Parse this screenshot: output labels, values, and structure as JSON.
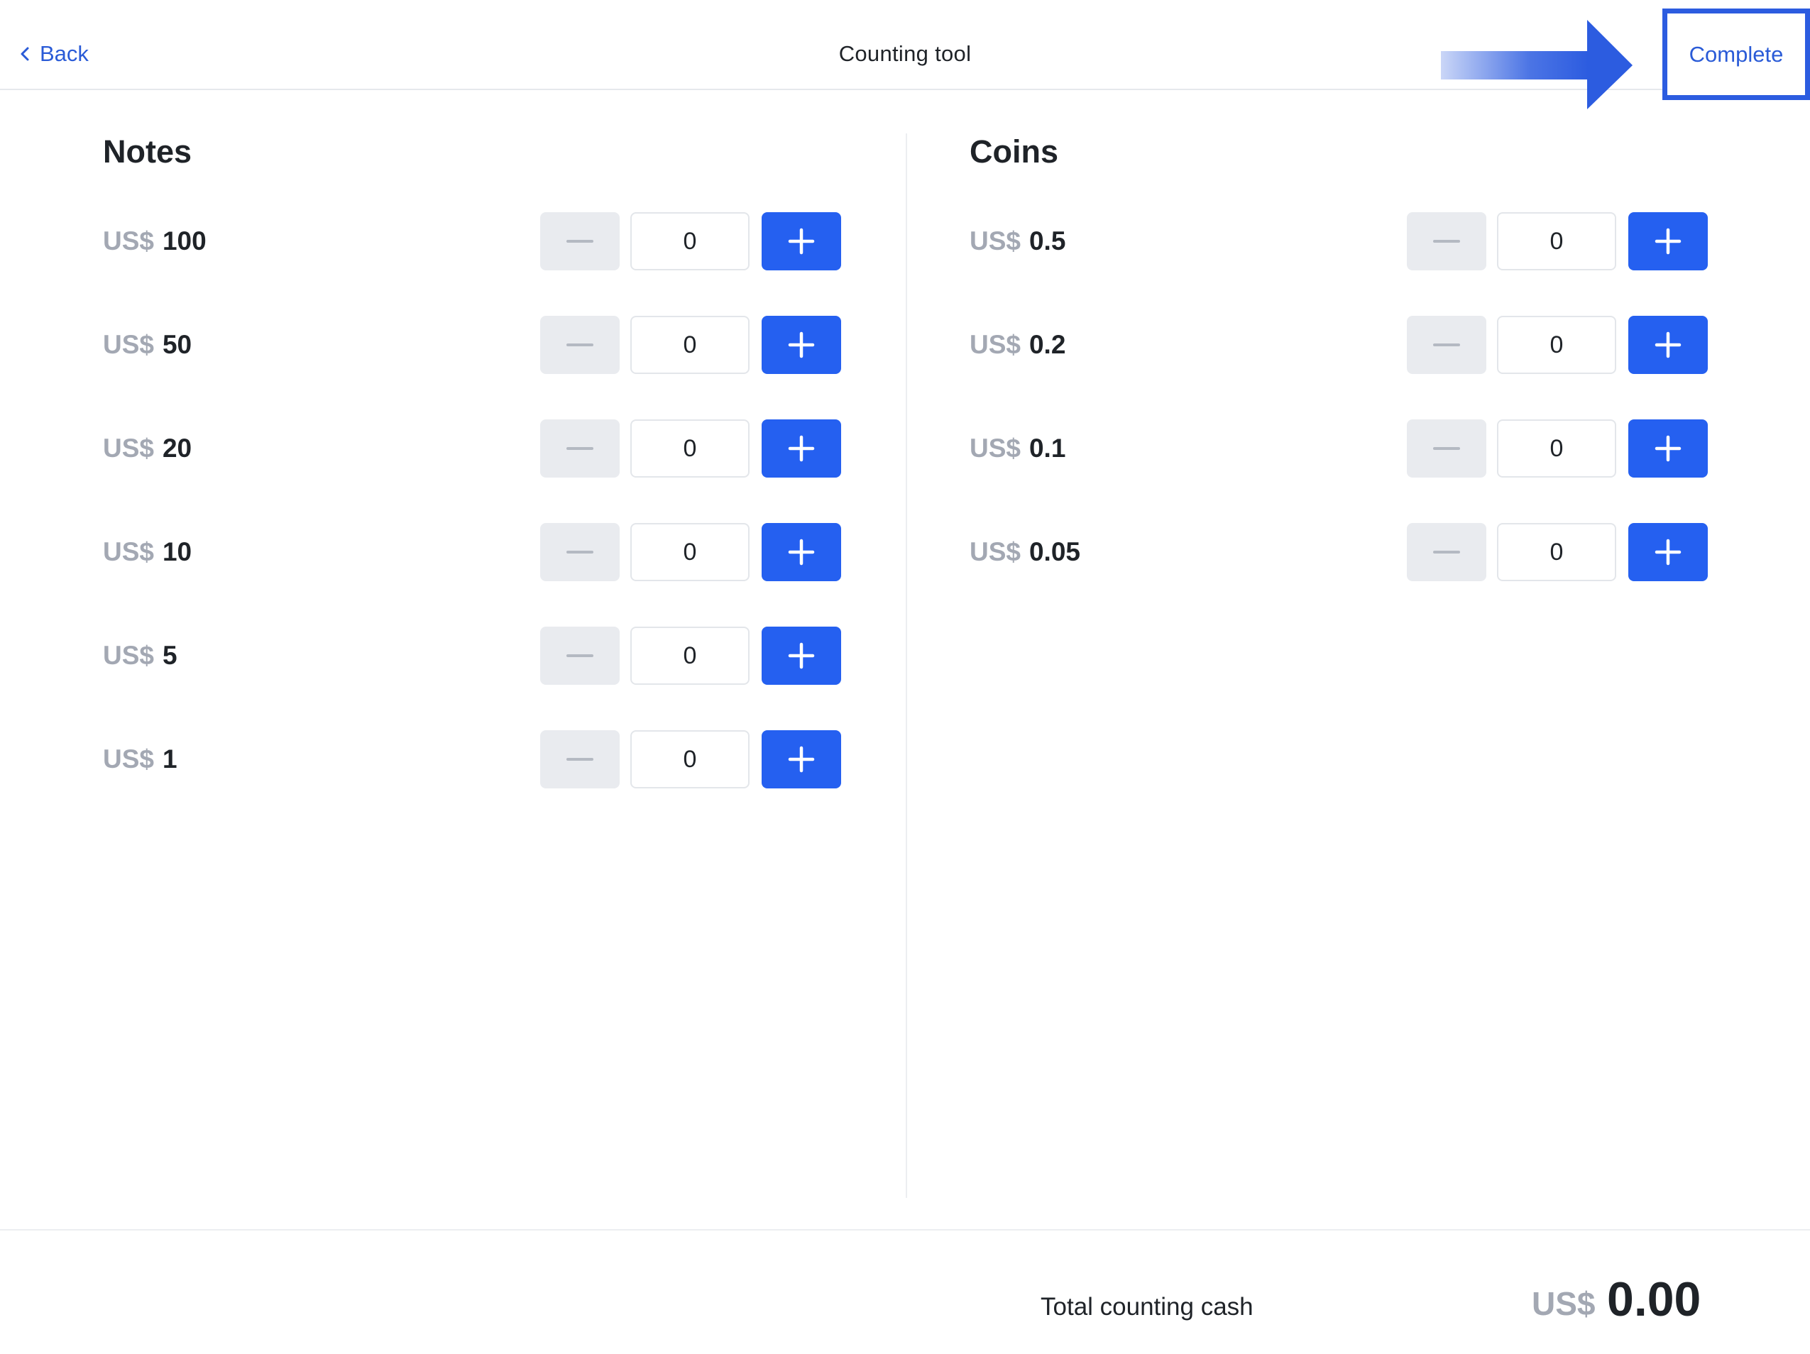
{
  "header": {
    "back_label": "Back",
    "title": "Counting tool",
    "complete_label": "Complete"
  },
  "colors": {
    "accent": "#2560f0",
    "link": "#2a5bd7",
    "muted": "#a3a8b3",
    "highlight_border": "#2c5ce0"
  },
  "notes": {
    "title": "Notes",
    "rows": [
      {
        "currency": "US$",
        "value": "100",
        "count": "0"
      },
      {
        "currency": "US$",
        "value": "50",
        "count": "0"
      },
      {
        "currency": "US$",
        "value": "20",
        "count": "0"
      },
      {
        "currency": "US$",
        "value": "10",
        "count": "0"
      },
      {
        "currency": "US$",
        "value": "5",
        "count": "0"
      },
      {
        "currency": "US$",
        "value": "1",
        "count": "0"
      }
    ]
  },
  "coins": {
    "title": "Coins",
    "rows": [
      {
        "currency": "US$",
        "value": "0.5",
        "count": "0"
      },
      {
        "currency": "US$",
        "value": "0.2",
        "count": "0"
      },
      {
        "currency": "US$",
        "value": "0.1",
        "count": "0"
      },
      {
        "currency": "US$",
        "value": "0.05",
        "count": "0"
      }
    ]
  },
  "footer": {
    "total_label": "Total counting cash",
    "currency": "US$",
    "total_value": "0.00"
  }
}
